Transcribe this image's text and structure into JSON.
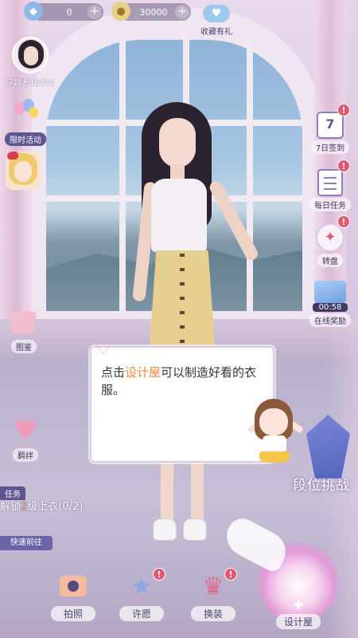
{
  "topbar": {
    "diamond_value": "0",
    "coin_value": "30000",
    "plus_label": "+",
    "gift_label": "收藏有礼"
  },
  "player": {
    "name": "穿越者15711"
  },
  "left_menu": {
    "limited_event_label": "限时活动",
    "album_label": "图鉴",
    "bond_label": "羁绊"
  },
  "right_menu": {
    "checkin_label": "7日签到",
    "checkin_day": "7",
    "daily_task_label": "每日任务",
    "wheel_label": "转盘",
    "online_timer": "00:58",
    "online_reward_label": "在线奖励",
    "badge_glyph": "!"
  },
  "dialog": {
    "text_before": "点击",
    "text_highlight": "设计屋",
    "text_after": "可以制造好看的衣服。"
  },
  "rank": {
    "label": "段位挑战"
  },
  "task": {
    "tag": "任务",
    "desc_before": "解锁",
    "desc_num": "2",
    "desc_after": "级上衣(0/2)",
    "go_label": "快速前往"
  },
  "bottom_nav": [
    {
      "label": "拍照"
    },
    {
      "label": "许愿"
    },
    {
      "label": "换装"
    },
    {
      "label": "设计屋"
    }
  ],
  "colors": {
    "accent_orange": "#f0883c",
    "badge_red": "#e4576f",
    "label_purple": "#4a3f6c"
  }
}
